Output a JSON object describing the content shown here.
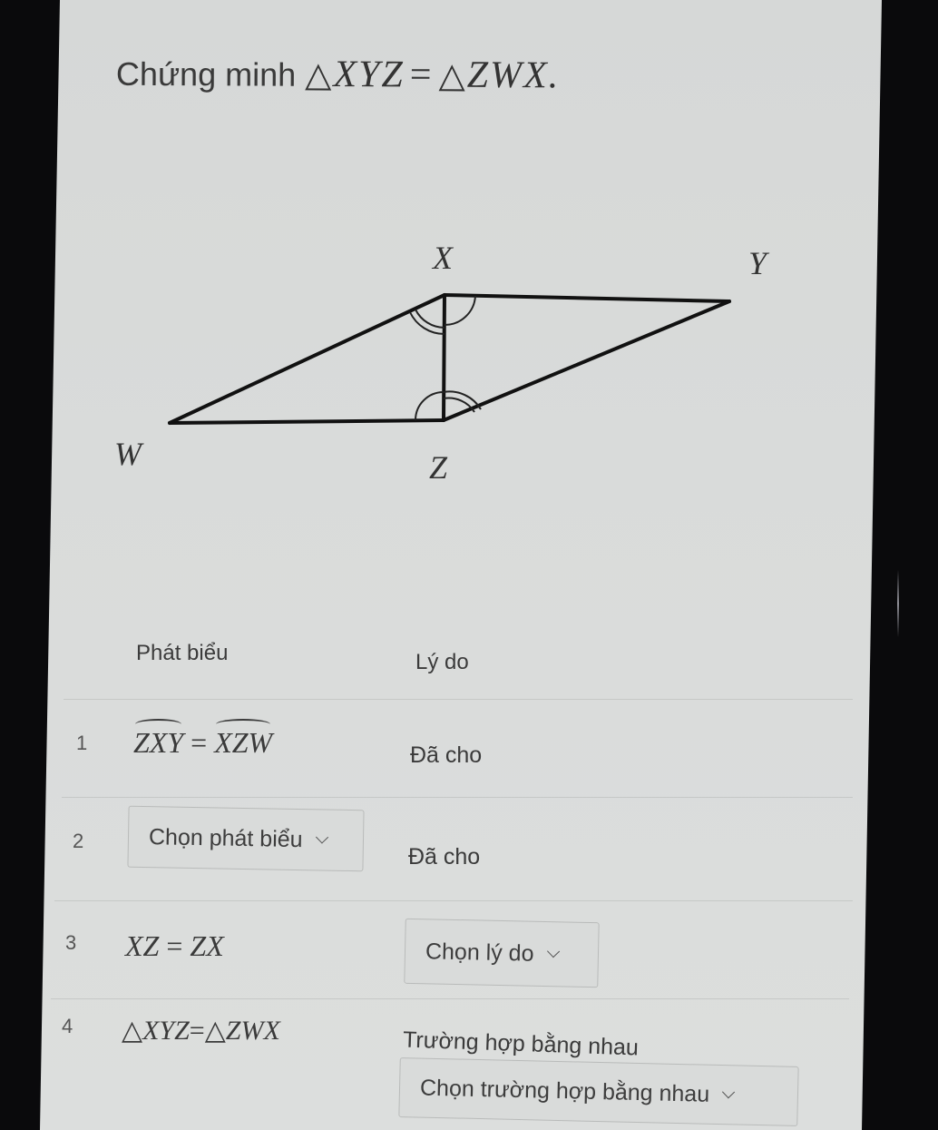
{
  "title": {
    "prefix": "Chứng minh",
    "math_left": "XYZ",
    "math_right": "ZWX",
    "triangle_symbol": "△",
    "equals": "=",
    "suffix": "."
  },
  "figure": {
    "points": {
      "X": {
        "label": "X"
      },
      "Y": {
        "label": "Y"
      },
      "Z": {
        "label": "Z"
      },
      "W": {
        "label": "W"
      }
    },
    "segments": [
      "XY",
      "YZ",
      "ZW",
      "WX",
      "XZ"
    ],
    "angle_marks": [
      {
        "angle": "ZXY",
        "arcs": 1
      },
      {
        "angle": "XZW",
        "arcs": 1
      },
      {
        "angle": "WXZ",
        "arcs": 2
      },
      {
        "angle": "XZY",
        "arcs": 2
      }
    ]
  },
  "table": {
    "headers": {
      "statement": "Phát biểu",
      "reason": "Lý do"
    },
    "rows": [
      {
        "num": "1",
        "statement_left": "ZXY",
        "statement_right": "XZW",
        "statement_equals": "=",
        "reason": "Đã cho"
      },
      {
        "num": "2",
        "statement_select": "Chọn phát biểu",
        "reason": "Đã cho"
      },
      {
        "num": "3",
        "statement_left": "XZ",
        "statement_equals": "=",
        "statement_right": "ZX",
        "reason_select": "Chọn lý do"
      },
      {
        "num": "4",
        "statement_triangle": "△",
        "statement_left": "XYZ",
        "statement_equals": "=",
        "statement_right": "ZWX",
        "reason": "Trường hợp bằng nhau",
        "reason_select": "Chọn trường hợp bằng nhau"
      }
    ]
  },
  "icons": {
    "dropdown": "chevron-down-icon"
  }
}
